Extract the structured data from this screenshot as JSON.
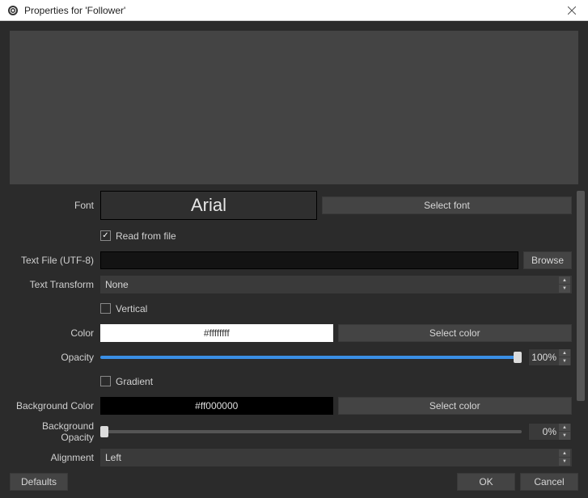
{
  "titlebar": {
    "title": "Properties for 'Follower'"
  },
  "form": {
    "font": {
      "label": "Font",
      "preview": "Arial",
      "select_btn": "Select font"
    },
    "read_from_file": {
      "label": "Read from file",
      "checked": true
    },
    "text_file": {
      "label": "Text File (UTF-8)",
      "value": "",
      "browse_btn": "Browse"
    },
    "text_transform": {
      "label": "Text Transform",
      "value": "None"
    },
    "vertical": {
      "label": "Vertical",
      "checked": false
    },
    "color": {
      "label": "Color",
      "value": "#ffffffff",
      "select_btn": "Select color"
    },
    "opacity": {
      "label": "Opacity",
      "value": "100%"
    },
    "gradient": {
      "label": "Gradient",
      "checked": false
    },
    "bg_color": {
      "label": "Background Color",
      "value": "#ff000000",
      "select_btn": "Select color"
    },
    "bg_opacity": {
      "label": "Background Opacity",
      "value": "0%"
    },
    "alignment": {
      "label": "Alignment",
      "value": "Left"
    }
  },
  "footer": {
    "defaults": "Defaults",
    "ok": "OK",
    "cancel": "Cancel"
  }
}
